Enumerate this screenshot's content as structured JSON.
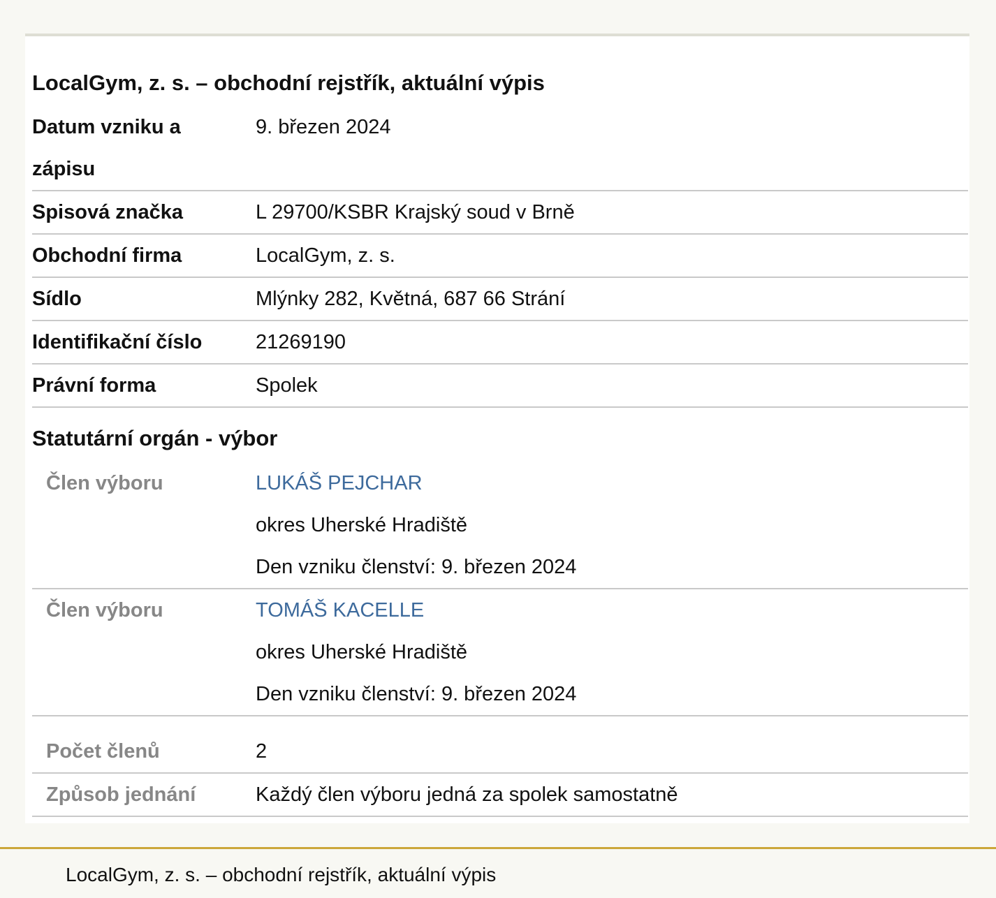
{
  "title": "LocalGym, z. s. – obchodní rejstřík, aktuální výpis",
  "fields": [
    {
      "label": "Datum vzniku a zápisu",
      "value": "9. březen 2024"
    },
    {
      "label": "Spisová značka",
      "value": "L 29700/KSBR Krajský soud v Brně"
    },
    {
      "label": "Obchodní firma",
      "value": "LocalGym, z. s."
    },
    {
      "label": "Sídlo",
      "value": "Mlýnky 282, Květná, 687 66 Strání"
    },
    {
      "label": "Identifikační číslo",
      "value": "21269190"
    },
    {
      "label": "Právní forma",
      "value": "Spolek"
    }
  ],
  "statutory": {
    "heading": "Statutární orgán - výbor",
    "members": [
      {
        "role": "Člen výboru",
        "name": "LUKÁŠ PEJCHAR",
        "district": "okres Uherské Hradiště",
        "since": "Den vzniku členství: 9. březen 2024"
      },
      {
        "role": "Člen výboru",
        "name": "TOMÁŠ KACELLE",
        "district": "okres Uherské Hradiště",
        "since": "Den vzniku členství: 9. březen 2024"
      }
    ],
    "member_count_label": "Počet členů",
    "member_count": "2",
    "acting_label": "Způsob jednání",
    "acting": "Každý člen výboru jedná za spolek samostatně"
  },
  "footer": "LocalGym, z. s. – obchodní rejstřík, aktuální výpis",
  "colors": {
    "link": "#3d6a9c",
    "footer_accent": "#cca73a",
    "muted_label": "#878787"
  }
}
